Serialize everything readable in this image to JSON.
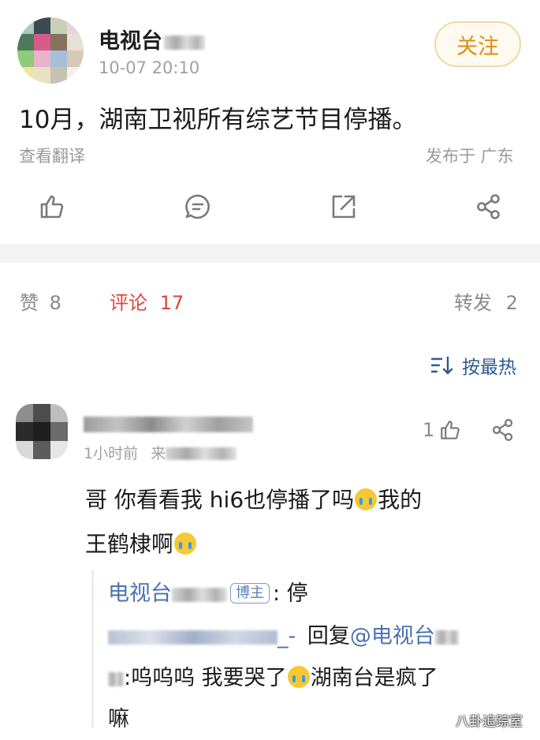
{
  "post": {
    "author": "电视台",
    "time": "10-07 20:10",
    "follow_label": "关注",
    "content": "10月，湖南卫视所有综艺节目停播。",
    "translate_label": "查看翻译",
    "location": "发布于 广东",
    "actions": [
      "like-icon",
      "comment-icon",
      "share-icon",
      "more-share-icon"
    ]
  },
  "tabs": {
    "likes_label": "赞",
    "likes_count": "8",
    "comments_label": "评论",
    "comments_count": "17",
    "reposts_label": "转发",
    "reposts_count": "2",
    "active_color": "#e0463a"
  },
  "sort": {
    "label": "按最热",
    "icon": "sort-icon"
  },
  "comment": {
    "time": "1小时前",
    "source_prefix": "来",
    "like_count": "1",
    "text_line1": "哥 你看看我 hi6也停播了吗",
    "text_line1_end": "我的",
    "text_line2": "王鹤棣啊",
    "reply": {
      "author": "电视台",
      "badge": "博主",
      "text": ": 停",
      "second_suffix": "_-",
      "second_action": "回复",
      "second_mention": "@电视台",
      "third_text1": ":呜呜呜 我要哭了",
      "third_text2": "湖南台是疯了",
      "third_text3": "嘛"
    }
  },
  "watermark": "八卦追踪室",
  "colors": {
    "link": "#4a72b0",
    "follow": "#e38b12",
    "muted": "#999999"
  }
}
